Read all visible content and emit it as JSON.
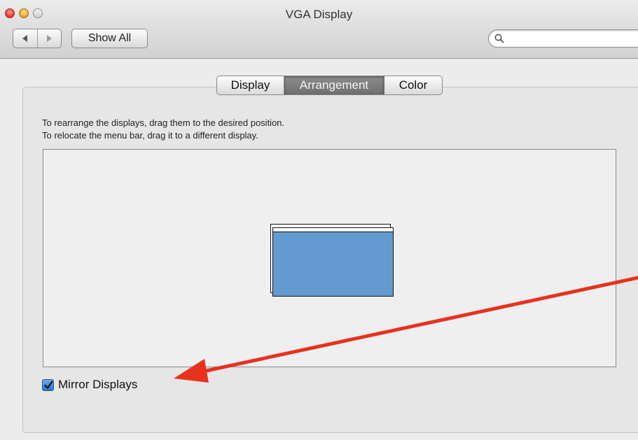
{
  "window": {
    "title": "VGA Display",
    "traffic_colors": {
      "close": "#e0443b",
      "minimize": "#e8a93a",
      "zoom": "#d8d8d8"
    }
  },
  "toolbar": {
    "back_icon": "back-arrow-icon",
    "forward_icon": "forward-arrow-icon",
    "show_all_label": "Show All",
    "search_placeholder": "",
    "search_value": ""
  },
  "tabs": [
    {
      "label": "Display",
      "selected": false
    },
    {
      "label": "Arrangement",
      "selected": true
    },
    {
      "label": "Color",
      "selected": false
    }
  ],
  "arrangement": {
    "instruction_1": "To rearrange the displays, drag them to the desired position.",
    "instruction_2": "To relocate the menu bar, drag it to a different display.",
    "display_color": "#639bd1",
    "mirror_label": "Mirror Displays",
    "mirror_checked": true
  },
  "annotation": {
    "type": "arrow",
    "color": "#e8321e",
    "points_to": "mirror-displays-checkbox"
  }
}
